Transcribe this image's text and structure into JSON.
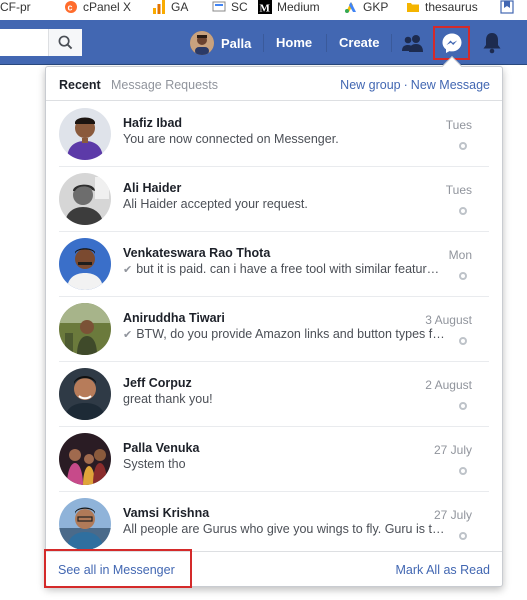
{
  "bookmarks": [
    {
      "label": "CF-pr",
      "icon": "folder-icon"
    },
    {
      "label": "cPanel X",
      "icon": "cpanel-icon"
    },
    {
      "label": "GA",
      "icon": "analytics-icon"
    },
    {
      "label": "SC",
      "icon": "search-console-icon"
    },
    {
      "label": "Medium",
      "icon": "medium-icon"
    },
    {
      "label": "GKP",
      "icon": "google-ads-icon"
    },
    {
      "label": "thesaurus",
      "icon": "folder-icon"
    }
  ],
  "header": {
    "profile_name": "Palla",
    "home_label": "Home",
    "create_label": "Create",
    "brand_color": "#4267b2"
  },
  "messages": {
    "tab_recent": "Recent",
    "tab_requests": "Message Requests",
    "new_group": "New group",
    "separator": "·",
    "new_message": "New Message",
    "threads": [
      {
        "name": "Hafiz Ibad",
        "snippet": "You are now connected on Messenger.",
        "time": "Tues",
        "sent": false
      },
      {
        "name": "Ali Haider",
        "snippet": "Ali Haider accepted your request.",
        "time": "Tues",
        "sent": false
      },
      {
        "name": "Venkateswara Rao Thota",
        "snippet": "but it is paid. can i have a free tool with similar features?",
        "time": "Mon",
        "sent": true
      },
      {
        "name": "Aniruddha Tiwari",
        "snippet": "BTW, do you provide Amazon links and button types for free?",
        "time": "3 August",
        "sent": true
      },
      {
        "name": "Jeff Corpuz",
        "snippet": "great thank you!",
        "time": "2 August",
        "sent": false
      },
      {
        "name": "Palla Venuka",
        "snippet": "System tho",
        "time": "27 July",
        "sent": false
      },
      {
        "name": "Vamsi Krishna",
        "snippet": "All people are Gurus who give you wings to fly. Guru is the one who",
        "time": "27 July",
        "sent": false
      }
    ],
    "see_all": "See all in Messenger",
    "mark_all_read": "Mark All as Read",
    "sent_tick": "✔"
  }
}
